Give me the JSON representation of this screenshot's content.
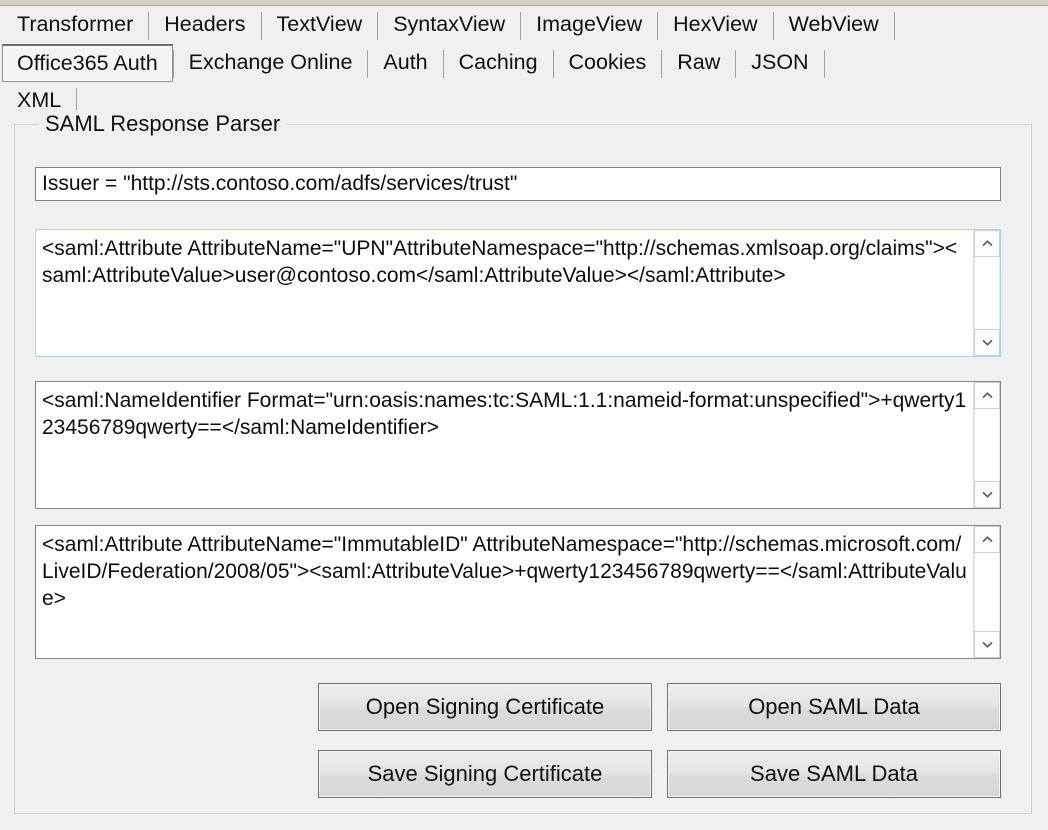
{
  "tabs": {
    "row1": [
      {
        "label": "Transformer",
        "selected": false
      },
      {
        "label": "Headers",
        "selected": false
      },
      {
        "label": "TextView",
        "selected": false
      },
      {
        "label": "SyntaxView",
        "selected": false
      },
      {
        "label": "ImageView",
        "selected": false
      },
      {
        "label": "HexView",
        "selected": false
      },
      {
        "label": "WebView",
        "selected": false
      }
    ],
    "row2": [
      {
        "label": "Office365 Auth",
        "selected": true
      },
      {
        "label": "Exchange Online",
        "selected": false
      },
      {
        "label": "Auth",
        "selected": false
      },
      {
        "label": "Caching",
        "selected": false
      },
      {
        "label": "Cookies",
        "selected": false
      },
      {
        "label": "Raw",
        "selected": false
      },
      {
        "label": "JSON",
        "selected": false
      }
    ],
    "row3": [
      {
        "label": "XML",
        "selected": false
      }
    ]
  },
  "group": {
    "legend": "SAML Response Parser"
  },
  "issuer_field": {
    "value": "Issuer = \"http://sts.contoso.com/adfs/services/trust\""
  },
  "attribute_upn_field": {
    "value": "<saml:Attribute AttributeName=\"UPN\"AttributeNamespace=\"http://schemas.xmlsoap.org/claims\"><saml:AttributeValue>user@contoso.com</saml:AttributeValue></saml:Attribute>",
    "focused": true
  },
  "nameidentifier_field": {
    "value": "<saml:NameIdentifier Format=\"urn:oasis:names:tc:SAML:1.1:nameid-format:unspecified\">+qwerty123456789qwerty==</saml:NameIdentifier>",
    "focused": false
  },
  "immutableid_field": {
    "value": "<saml:Attribute AttributeName=\"ImmutableID\" AttributeNamespace=\"http://schemas.microsoft.com/LiveID/Federation/2008/05\"><saml:AttributeValue>+qwerty123456789qwerty==</saml:AttributeValue>",
    "focused": false
  },
  "buttons": {
    "open_signing_certificate": "Open Signing Certificate",
    "open_saml_data": "Open SAML Data",
    "save_signing_certificate": "Save Signing Certificate",
    "save_saml_data": "Save SAML Data"
  },
  "icons": {
    "scroll_up": "chevron-up-icon",
    "scroll_down": "chevron-down-icon"
  },
  "colors": {
    "window_background": "#f0f0f0",
    "field_background": "#ffffff",
    "field_border": "#848484",
    "focus_border": "#a9d3ea",
    "button_face": "#e2e2e2",
    "button_border": "#707070",
    "text": "#0d0d0d",
    "tab_separator": "#a0a0a0",
    "groupbox_border": "#d0cfcd"
  }
}
